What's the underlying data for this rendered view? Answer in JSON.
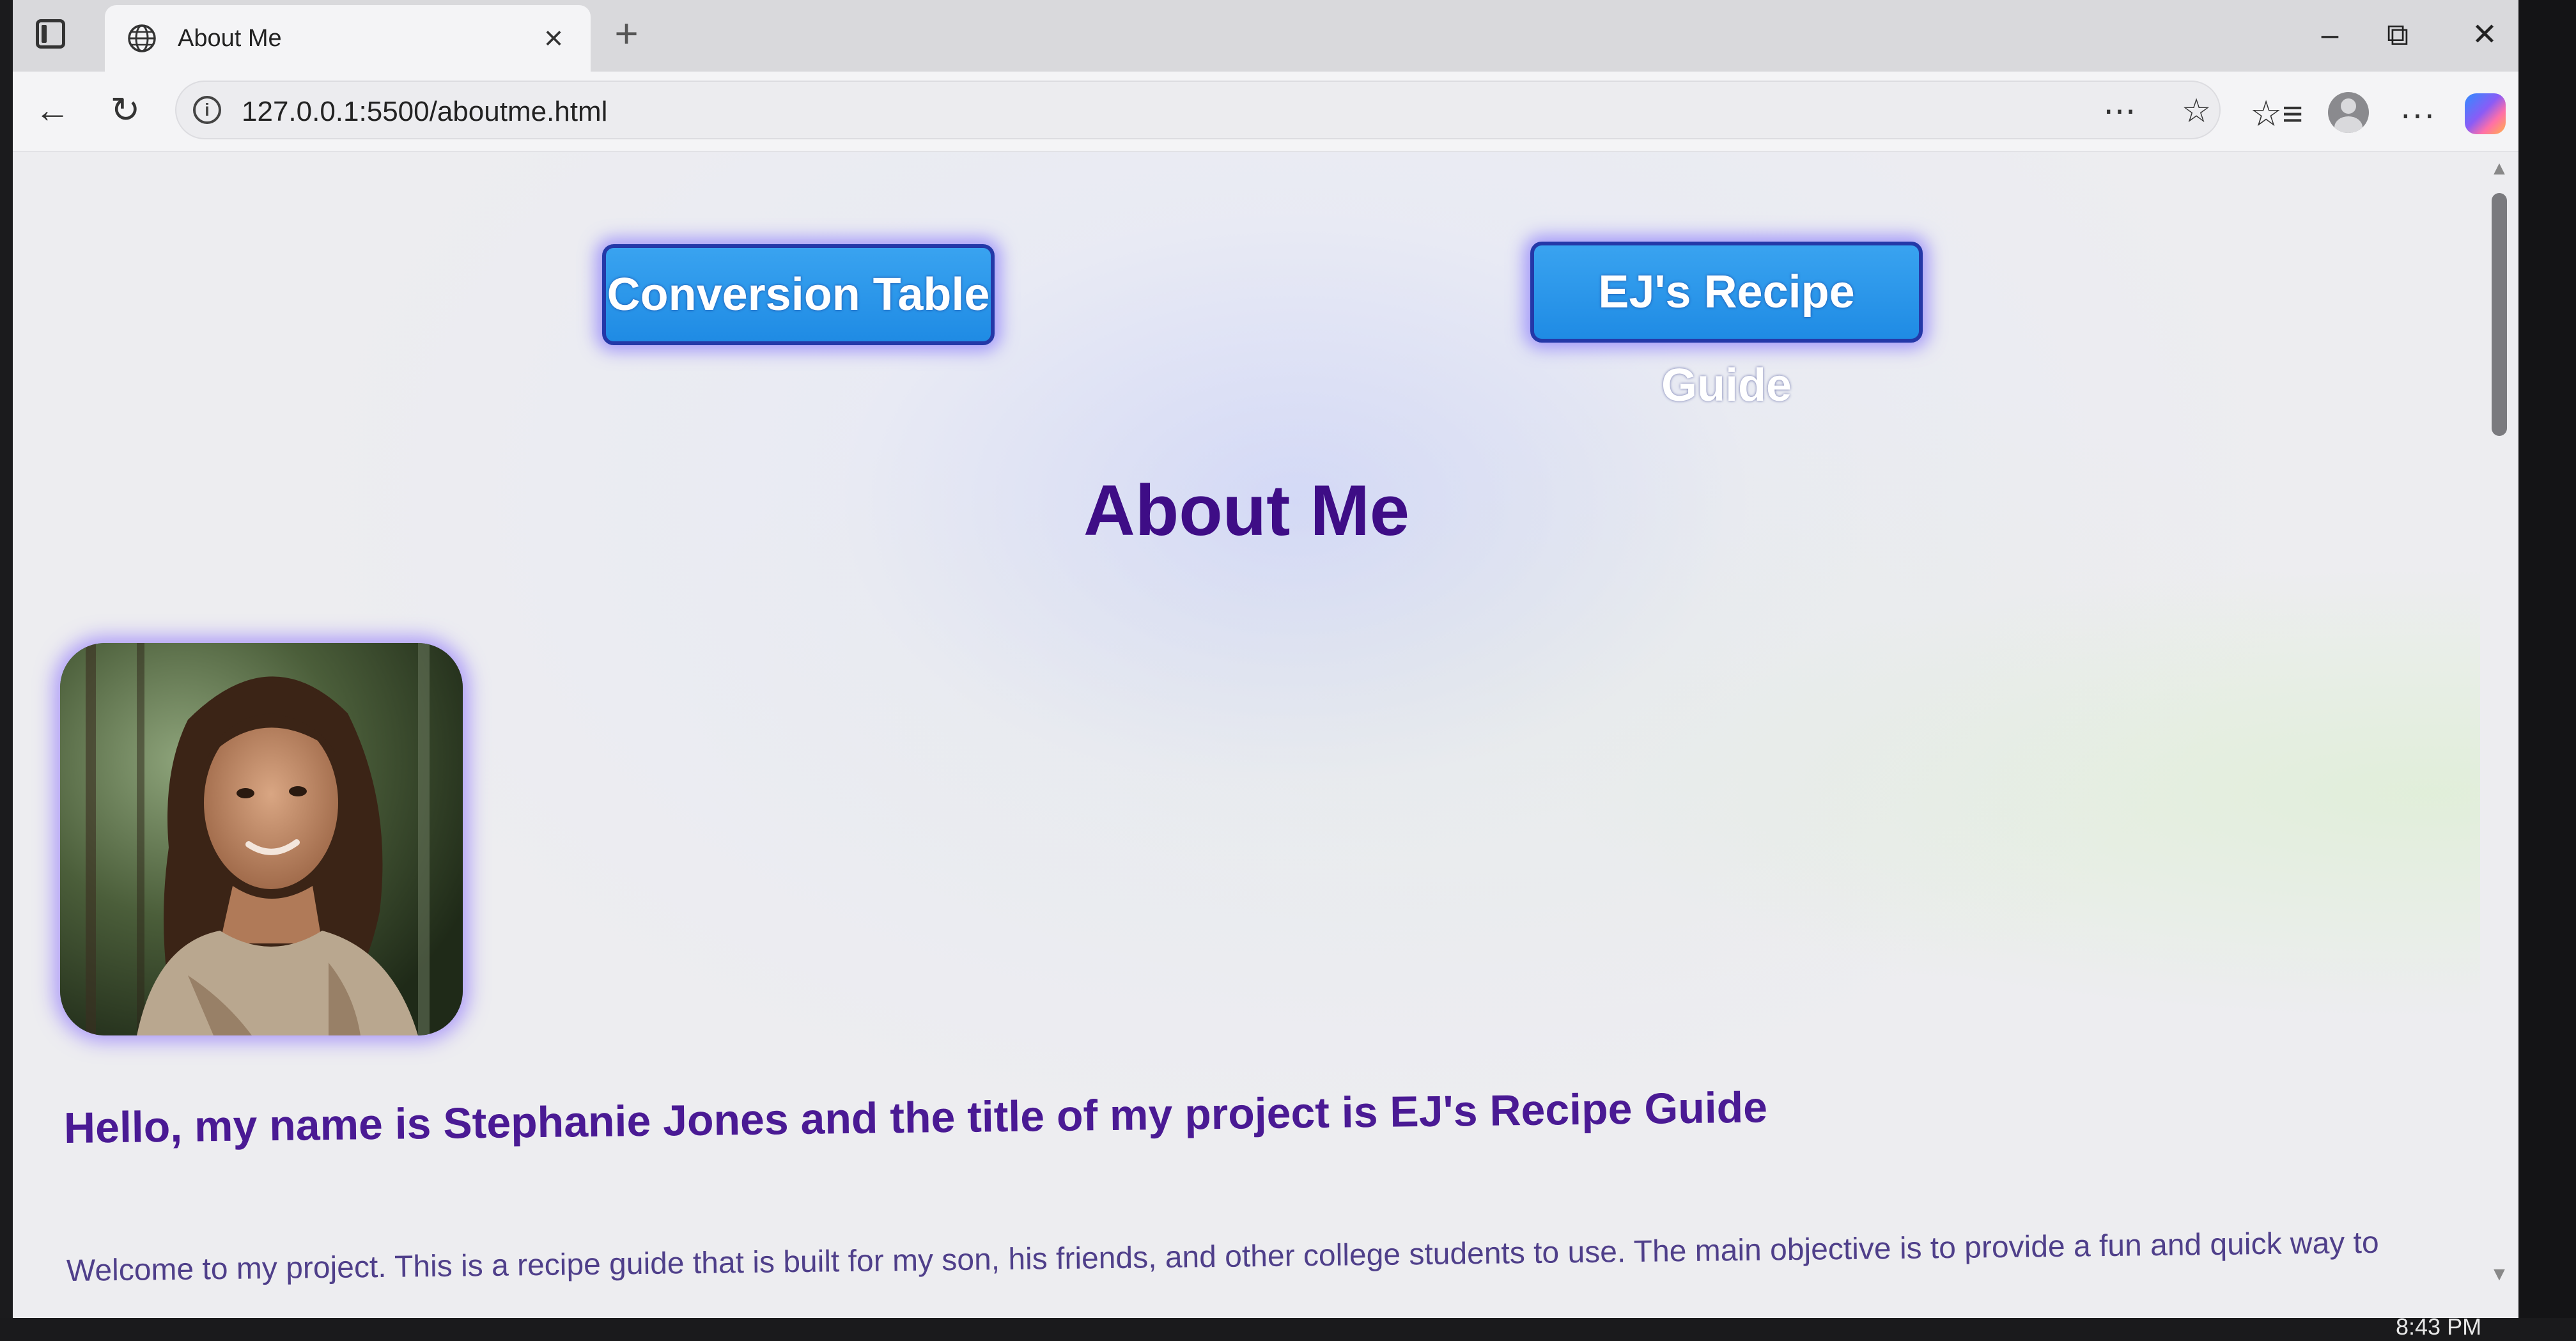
{
  "browser": {
    "tab": {
      "title": "About Me",
      "close_icon": "×"
    },
    "new_tab_icon": "+",
    "window_controls": {
      "minimize": "–",
      "restore": "⧉",
      "close": "✕"
    },
    "nav": {
      "back": "←",
      "reload": "↻"
    },
    "address": {
      "url": "127.0.0.1:5500/aboutme.html"
    },
    "toolbar_icons": {
      "read_aloud": "⋯",
      "favorite": "☆",
      "favorites": "☆≡",
      "menu": "···"
    }
  },
  "page": {
    "buttons": {
      "conversion_table": "Conversion Table",
      "recipe_guide": "EJ's Recipe Guide"
    },
    "title": "About Me",
    "intro_heading": "Hello, my name is Stephanie Jones and the title of my project is EJ's Recipe Guide",
    "intro_text": "Welcome to my project. This is a recipe guide that is built for my son, his friends, and other college students to use. The main objective is to provide a fun and quick way to"
  },
  "taskbar": {
    "clock": "8:43 PM"
  },
  "colors": {
    "button_fill": "#2a95ea",
    "button_border": "#2438a8",
    "title": "#3e0d86",
    "heading": "#4a1a94"
  }
}
